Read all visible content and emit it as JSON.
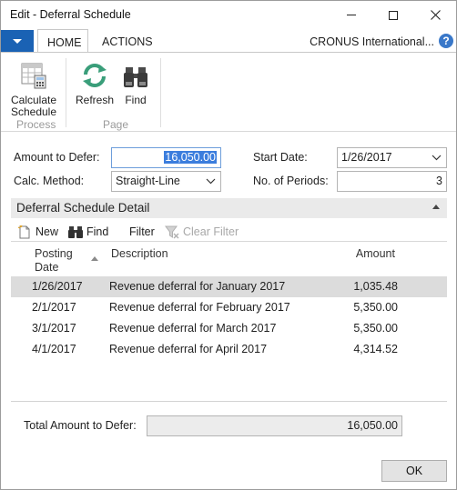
{
  "window": {
    "title": "Edit - Deferral Schedule"
  },
  "ribbon": {
    "tabs": [
      {
        "label": "HOME"
      },
      {
        "label": "ACTIONS"
      }
    ],
    "company": "CRONUS International...",
    "groups": [
      {
        "label": "Process",
        "buttons": [
          {
            "label_line1": "Calculate",
            "label_line2": "Schedule",
            "icon": "calculator-icon"
          }
        ]
      },
      {
        "label": "Page",
        "buttons": [
          {
            "label": "Refresh",
            "icon": "refresh-icon"
          },
          {
            "label": "Find",
            "icon": "binoculars-icon"
          }
        ]
      }
    ]
  },
  "form": {
    "amount_to_defer": {
      "label": "Amount to Defer:",
      "value": "16,050.00"
    },
    "calc_method": {
      "label": "Calc. Method:",
      "value": "Straight-Line"
    },
    "start_date": {
      "label": "Start Date:",
      "value": "1/26/2017"
    },
    "no_of_periods": {
      "label": "No. of Periods:",
      "value": "3"
    }
  },
  "detail": {
    "title": "Deferral Schedule Detail",
    "toolbar": {
      "new": "New",
      "find": "Find",
      "filter": "Filter",
      "clear_filter": "Clear Filter"
    },
    "columns": {
      "posting_date_line1": "Posting",
      "posting_date_line2": "Date",
      "description": "Description",
      "amount": "Amount"
    },
    "rows": [
      {
        "date": "1/26/2017",
        "description": "Revenue deferral for January 2017",
        "amount": "1,035.48"
      },
      {
        "date": "2/1/2017",
        "description": "Revenue deferral for February 2017",
        "amount": "5,350.00"
      },
      {
        "date": "3/1/2017",
        "description": "Revenue deferral for March 2017",
        "amount": "5,350.00"
      },
      {
        "date": "4/1/2017",
        "description": "Revenue deferral for April 2017",
        "amount": "4,314.52"
      }
    ]
  },
  "footer": {
    "total_label": "Total Amount to Defer:",
    "total_value": "16,050.00",
    "ok_label": "OK"
  },
  "colors": {
    "accent": "#1a62b4",
    "selection": "#3b7ddd",
    "row_selected": "#dcdcdc",
    "section_bg": "#eaeaea"
  }
}
